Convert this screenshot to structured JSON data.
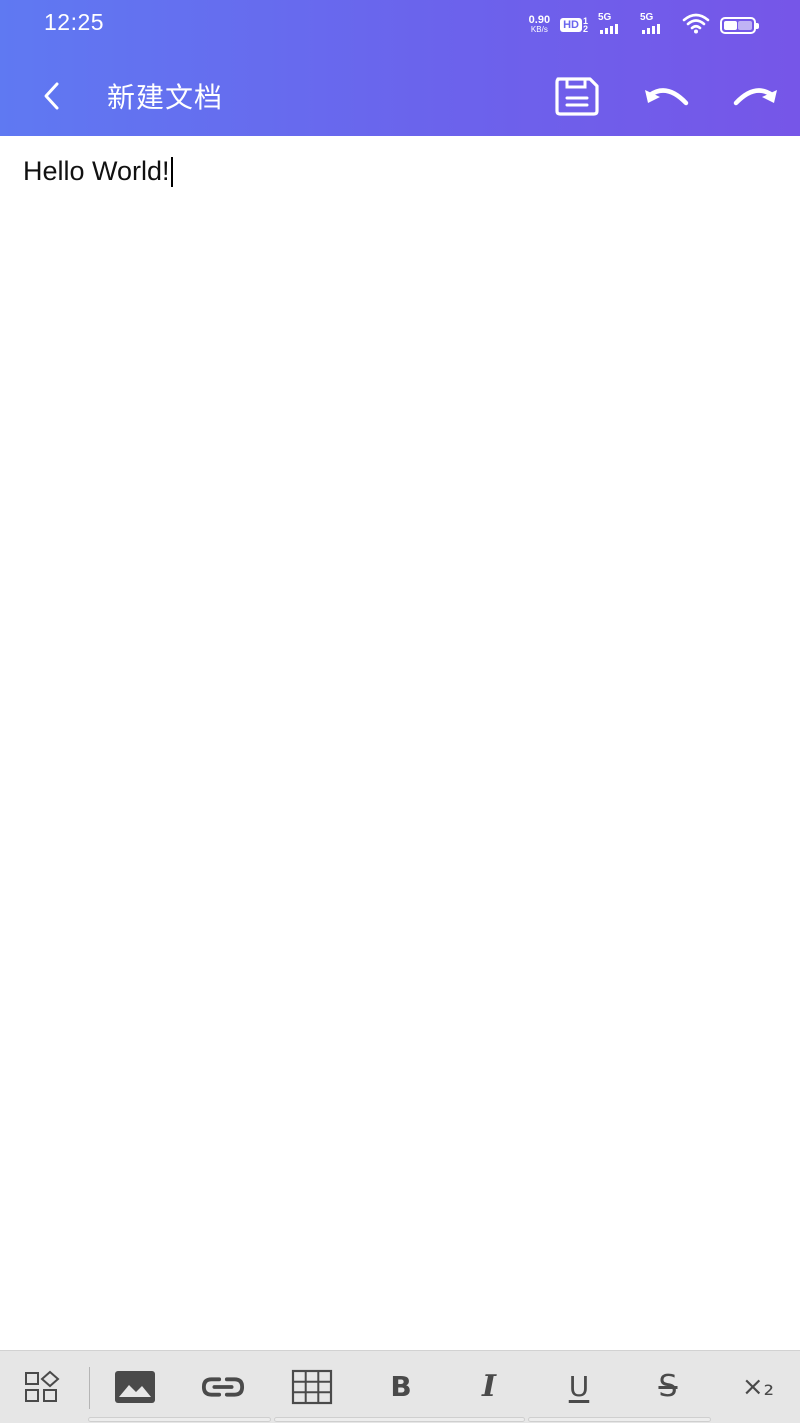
{
  "status_bar": {
    "time": "12:25",
    "net_speed_value": "0.90",
    "net_speed_unit": "KB/s",
    "hd_label": "HD",
    "hd_sub_top": "1",
    "hd_sub_bottom": "2",
    "sim1_label": "5G",
    "sim2_label": "5G",
    "icons": [
      "hd-icon",
      "signal-5g-icon",
      "signal-5g-icon",
      "wifi-icon",
      "battery-icon"
    ]
  },
  "header": {
    "title": "新建文档",
    "back_icon": "chevron-left-icon",
    "save_icon": "save-icon",
    "undo_icon": "undo-icon",
    "redo_icon": "redo-icon"
  },
  "editor": {
    "content": "Hello World!"
  },
  "format_bar": {
    "items": [
      {
        "name": "more-tools",
        "icon": "grid-shapes-icon"
      },
      {
        "name": "insert-image",
        "icon": "image-icon"
      },
      {
        "name": "insert-link",
        "icon": "link-icon"
      },
      {
        "name": "insert-table",
        "icon": "table-icon"
      },
      {
        "name": "bold",
        "icon": "bold-icon",
        "glyph": "B"
      },
      {
        "name": "italic",
        "icon": "italic-icon",
        "glyph": "I"
      },
      {
        "name": "underline",
        "icon": "underline-icon",
        "glyph": "U"
      },
      {
        "name": "strikethrough",
        "icon": "strikethrough-icon",
        "glyph": "S"
      },
      {
        "name": "subscript",
        "icon": "subscript-icon",
        "glyph": "×₂"
      }
    ]
  },
  "colors": {
    "header_gradient_start": "#5f79f2",
    "header_gradient_end": "#7656e8",
    "toolbar_bg": "#e6e6e6",
    "icon_gray": "#4a4a4a"
  }
}
